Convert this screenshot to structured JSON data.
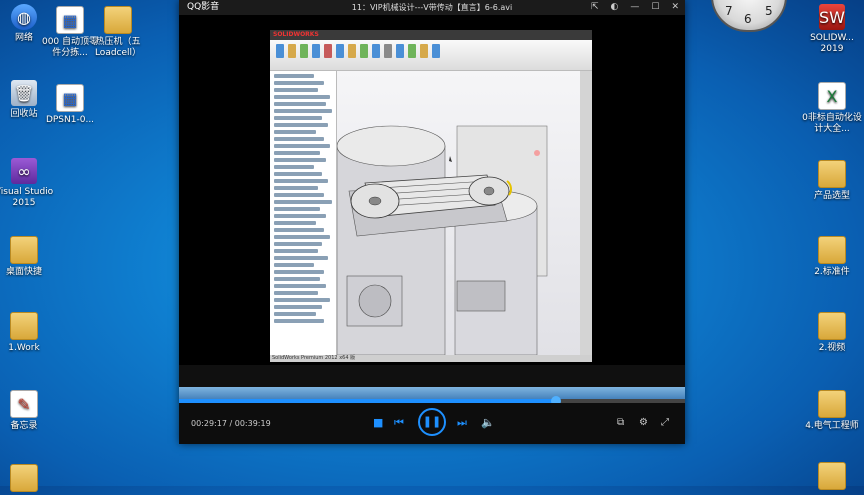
{
  "desktop_left": [
    {
      "label": "网络",
      "icon": "network-icon"
    },
    {
      "label": "000 自动顶零件分拣...",
      "icon": "file-icon"
    },
    {
      "label": "热压机（五Loadcell）",
      "icon": "folder-icon"
    },
    {
      "label": "回收站",
      "icon": "recycle-bin-icon"
    },
    {
      "label": "DPSN1-0...",
      "icon": "file-icon"
    },
    {
      "label": "Visual Studio 2015",
      "icon": "visual-studio-icon"
    },
    {
      "label": "桌面快捷",
      "icon": "folder-icon"
    },
    {
      "label": "1.Work",
      "icon": "folder-icon"
    },
    {
      "label": "备忘录",
      "icon": "note-icon"
    }
  ],
  "desktop_right": [
    {
      "label": "SOLIDW... 2019",
      "icon": "solidworks-icon"
    },
    {
      "label": "0非标自动化设计大全...",
      "icon": "excel-icon"
    },
    {
      "label": "产品选型",
      "icon": "folder-icon"
    },
    {
      "label": "2.标准件",
      "icon": "folder-icon"
    },
    {
      "label": "2.视频",
      "icon": "folder-icon"
    },
    {
      "label": "4.电气工程师",
      "icon": "folder-icon"
    }
  ],
  "clock": {
    "numbers": [
      "7",
      "6",
      "5"
    ]
  },
  "player": {
    "brand": "QQ影音",
    "title": "11：VIP机械设计---V带传动【直言】6-6.avi",
    "time_current": "00:29:17",
    "time_total": "00:39:19",
    "progress": 0.745
  },
  "recorded": {
    "logo": "SOLIDWORKS",
    "status": "SolidWorks Premium 2012 x64 版"
  }
}
